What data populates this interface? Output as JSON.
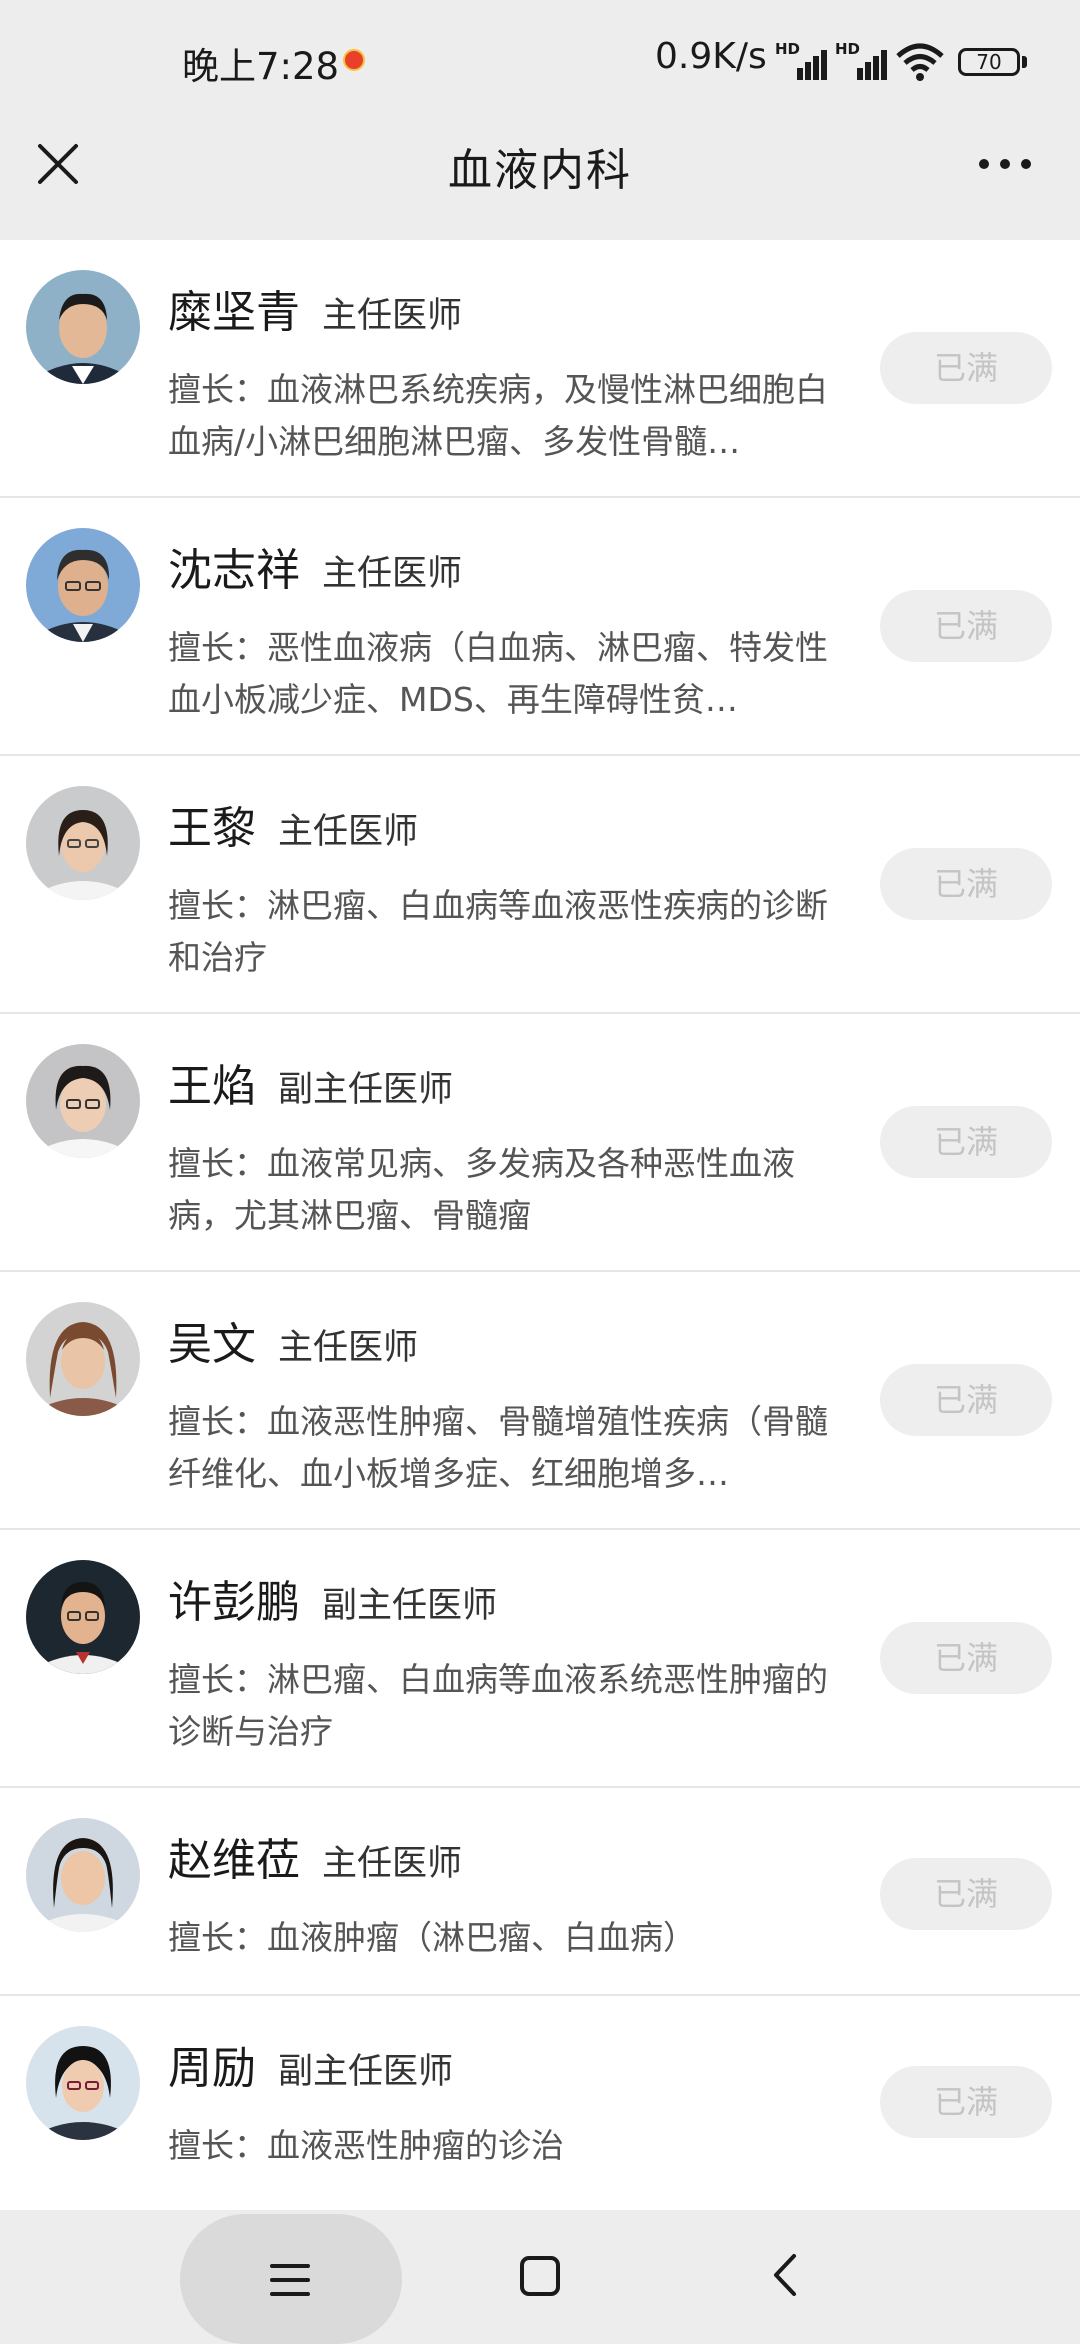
{
  "status_bar": {
    "time": "晚上7:28",
    "speed": "0.9K/s",
    "hd1": "HD",
    "hd2": "HD",
    "battery": "70"
  },
  "header": {
    "title": "血液内科"
  },
  "doctors": [
    {
      "name": "糜坚青",
      "title": "主任医师",
      "specialty": "擅长：血液淋巴系统疾病，及慢性淋巴细胞白血病/小淋巴细胞淋巴瘤、多发性骨髓…",
      "status": "已满"
    },
    {
      "name": "沈志祥",
      "title": "主任医师",
      "specialty": "擅长：恶性血液病（白血病、淋巴瘤、特发性血小板减少症、MDS、再生障碍性贫…",
      "status": "已满"
    },
    {
      "name": "王黎",
      "title": "主任医师",
      "specialty": "擅长：淋巴瘤、白血病等血液恶性疾病的诊断和治疗",
      "status": "已满"
    },
    {
      "name": "王焰",
      "title": "副主任医师",
      "specialty": "擅长：血液常见病、多发病及各种恶性血液病，尤其淋巴瘤、骨髓瘤",
      "status": "已满"
    },
    {
      "name": "吴文",
      "title": "主任医师",
      "specialty": "擅长：血液恶性肿瘤、骨髓增殖性疾病（骨髓纤维化、血小板增多症、红细胞增多…",
      "status": "已满"
    },
    {
      "name": "许彭鹏",
      "title": "副主任医师",
      "specialty": "擅长：淋巴瘤、白血病等血液系统恶性肿瘤的诊断与治疗",
      "status": "已满"
    },
    {
      "name": "赵维莅",
      "title": "主任医师",
      "specialty": "擅长：血液肿瘤（淋巴瘤、白血病）",
      "status": "已满"
    },
    {
      "name": "周励",
      "title": "副主任医师",
      "specialty": "擅长：血液恶性肿瘤的诊治",
      "status": "已满"
    }
  ],
  "icons": {
    "close": "close-icon",
    "more": "more-icon",
    "menu": "menu-icon",
    "home": "home-icon",
    "back": "back-icon"
  }
}
